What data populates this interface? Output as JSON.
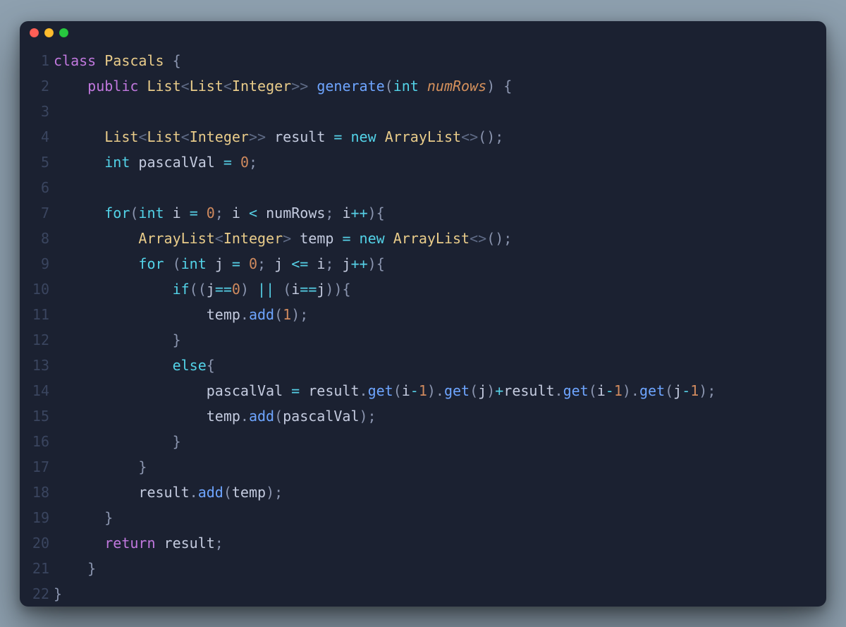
{
  "window": {
    "traffic": [
      "close",
      "minimize",
      "zoom"
    ]
  },
  "theme": {
    "background": "#1b2131",
    "page_background": "#8ea0af",
    "keyword": "#c178de",
    "control": "#53d3e8",
    "class": "#e9cc8a",
    "function": "#6ea5ff",
    "identifier": "#c4cbdf",
    "punct": "#8b95af",
    "angle": "#5f6b86",
    "operator": "#56d0e6",
    "number": "#d08a5e",
    "parameter": "#d6915c",
    "gutter": "#3a455f"
  },
  "lines": [
    {
      "n": "1",
      "tokens": [
        {
          "c": "kw",
          "t": "class"
        },
        {
          "c": "sp",
          "t": " "
        },
        {
          "c": "cls",
          "t": "Pascals"
        },
        {
          "c": "sp",
          "t": " "
        },
        {
          "c": "punct",
          "t": "{"
        }
      ]
    },
    {
      "n": "2",
      "tokens": [
        {
          "c": "sp",
          "t": "    "
        },
        {
          "c": "kw",
          "t": "public"
        },
        {
          "c": "sp",
          "t": " "
        },
        {
          "c": "cls",
          "t": "List"
        },
        {
          "c": "angle",
          "t": "<"
        },
        {
          "c": "cls",
          "t": "List"
        },
        {
          "c": "angle",
          "t": "<"
        },
        {
          "c": "cls",
          "t": "Integer"
        },
        {
          "c": "angle",
          "t": ">>"
        },
        {
          "c": "sp",
          "t": " "
        },
        {
          "c": "fn",
          "t": "generate"
        },
        {
          "c": "punct",
          "t": "("
        },
        {
          "c": "type",
          "t": "int"
        },
        {
          "c": "sp",
          "t": " "
        },
        {
          "c": "param",
          "t": "numRows"
        },
        {
          "c": "punct",
          "t": ")"
        },
        {
          "c": "sp",
          "t": " "
        },
        {
          "c": "punct",
          "t": "{"
        }
      ]
    },
    {
      "n": "3",
      "tokens": []
    },
    {
      "n": "4",
      "tokens": [
        {
          "c": "sp",
          "t": "      "
        },
        {
          "c": "cls",
          "t": "List"
        },
        {
          "c": "angle",
          "t": "<"
        },
        {
          "c": "cls",
          "t": "List"
        },
        {
          "c": "angle",
          "t": "<"
        },
        {
          "c": "cls",
          "t": "Integer"
        },
        {
          "c": "angle",
          "t": ">>"
        },
        {
          "c": "sp",
          "t": " "
        },
        {
          "c": "ident",
          "t": "result"
        },
        {
          "c": "sp",
          "t": " "
        },
        {
          "c": "op",
          "t": "="
        },
        {
          "c": "sp",
          "t": " "
        },
        {
          "c": "ctrl",
          "t": "new"
        },
        {
          "c": "sp",
          "t": " "
        },
        {
          "c": "cls",
          "t": "ArrayList"
        },
        {
          "c": "angle",
          "t": "<>"
        },
        {
          "c": "punct",
          "t": "();"
        }
      ]
    },
    {
      "n": "5",
      "tokens": [
        {
          "c": "sp",
          "t": "      "
        },
        {
          "c": "type",
          "t": "int"
        },
        {
          "c": "sp",
          "t": " "
        },
        {
          "c": "ident",
          "t": "pascalVal"
        },
        {
          "c": "sp",
          "t": " "
        },
        {
          "c": "op",
          "t": "="
        },
        {
          "c": "sp",
          "t": " "
        },
        {
          "c": "num",
          "t": "0"
        },
        {
          "c": "punct",
          "t": ";"
        }
      ]
    },
    {
      "n": "6",
      "tokens": []
    },
    {
      "n": "7",
      "tokens": [
        {
          "c": "sp",
          "t": "      "
        },
        {
          "c": "ctrl",
          "t": "for"
        },
        {
          "c": "punct",
          "t": "("
        },
        {
          "c": "type",
          "t": "int"
        },
        {
          "c": "sp",
          "t": " "
        },
        {
          "c": "ident",
          "t": "i"
        },
        {
          "c": "sp",
          "t": " "
        },
        {
          "c": "op",
          "t": "="
        },
        {
          "c": "sp",
          "t": " "
        },
        {
          "c": "num",
          "t": "0"
        },
        {
          "c": "punct",
          "t": ";"
        },
        {
          "c": "sp",
          "t": " "
        },
        {
          "c": "ident",
          "t": "i"
        },
        {
          "c": "sp",
          "t": " "
        },
        {
          "c": "op",
          "t": "<"
        },
        {
          "c": "sp",
          "t": " "
        },
        {
          "c": "ident",
          "t": "numRows"
        },
        {
          "c": "punct",
          "t": ";"
        },
        {
          "c": "sp",
          "t": " "
        },
        {
          "c": "ident",
          "t": "i"
        },
        {
          "c": "op",
          "t": "++"
        },
        {
          "c": "punct",
          "t": "){"
        }
      ]
    },
    {
      "n": "8",
      "tokens": [
        {
          "c": "sp",
          "t": "          "
        },
        {
          "c": "cls",
          "t": "ArrayList"
        },
        {
          "c": "angle",
          "t": "<"
        },
        {
          "c": "cls",
          "t": "Integer"
        },
        {
          "c": "angle",
          "t": ">"
        },
        {
          "c": "sp",
          "t": " "
        },
        {
          "c": "ident",
          "t": "temp"
        },
        {
          "c": "sp",
          "t": " "
        },
        {
          "c": "op",
          "t": "="
        },
        {
          "c": "sp",
          "t": " "
        },
        {
          "c": "ctrl",
          "t": "new"
        },
        {
          "c": "sp",
          "t": " "
        },
        {
          "c": "cls",
          "t": "ArrayList"
        },
        {
          "c": "angle",
          "t": "<>"
        },
        {
          "c": "punct",
          "t": "();"
        }
      ]
    },
    {
      "n": "9",
      "tokens": [
        {
          "c": "sp",
          "t": "          "
        },
        {
          "c": "ctrl",
          "t": "for"
        },
        {
          "c": "sp",
          "t": " "
        },
        {
          "c": "punct",
          "t": "("
        },
        {
          "c": "type",
          "t": "int"
        },
        {
          "c": "sp",
          "t": " "
        },
        {
          "c": "ident",
          "t": "j"
        },
        {
          "c": "sp",
          "t": " "
        },
        {
          "c": "op",
          "t": "="
        },
        {
          "c": "sp",
          "t": " "
        },
        {
          "c": "num",
          "t": "0"
        },
        {
          "c": "punct",
          "t": ";"
        },
        {
          "c": "sp",
          "t": " "
        },
        {
          "c": "ident",
          "t": "j"
        },
        {
          "c": "sp",
          "t": " "
        },
        {
          "c": "op",
          "t": "<="
        },
        {
          "c": "sp",
          "t": " "
        },
        {
          "c": "ident",
          "t": "i"
        },
        {
          "c": "punct",
          "t": ";"
        },
        {
          "c": "sp",
          "t": " "
        },
        {
          "c": "ident",
          "t": "j"
        },
        {
          "c": "op",
          "t": "++"
        },
        {
          "c": "punct",
          "t": "){"
        }
      ]
    },
    {
      "n": "10",
      "tokens": [
        {
          "c": "sp",
          "t": "              "
        },
        {
          "c": "ctrl",
          "t": "if"
        },
        {
          "c": "punct",
          "t": "(("
        },
        {
          "c": "ident",
          "t": "j"
        },
        {
          "c": "op",
          "t": "=="
        },
        {
          "c": "num",
          "t": "0"
        },
        {
          "c": "punct",
          "t": ")"
        },
        {
          "c": "sp",
          "t": " "
        },
        {
          "c": "op",
          "t": "||"
        },
        {
          "c": "sp",
          "t": " "
        },
        {
          "c": "punct",
          "t": "("
        },
        {
          "c": "ident",
          "t": "i"
        },
        {
          "c": "op",
          "t": "=="
        },
        {
          "c": "ident",
          "t": "j"
        },
        {
          "c": "punct",
          "t": ")){"
        }
      ]
    },
    {
      "n": "11",
      "tokens": [
        {
          "c": "sp",
          "t": "                  "
        },
        {
          "c": "ident",
          "t": "temp"
        },
        {
          "c": "punct",
          "t": "."
        },
        {
          "c": "fn",
          "t": "add"
        },
        {
          "c": "punct",
          "t": "("
        },
        {
          "c": "num",
          "t": "1"
        },
        {
          "c": "punct",
          "t": ");"
        }
      ]
    },
    {
      "n": "12",
      "tokens": [
        {
          "c": "sp",
          "t": "              "
        },
        {
          "c": "punct",
          "t": "}"
        }
      ]
    },
    {
      "n": "13",
      "tokens": [
        {
          "c": "sp",
          "t": "              "
        },
        {
          "c": "ctrl",
          "t": "else"
        },
        {
          "c": "punct",
          "t": "{"
        }
      ]
    },
    {
      "n": "14",
      "tokens": [
        {
          "c": "sp",
          "t": "                  "
        },
        {
          "c": "ident",
          "t": "pascalVal"
        },
        {
          "c": "sp",
          "t": " "
        },
        {
          "c": "op",
          "t": "="
        },
        {
          "c": "sp",
          "t": " "
        },
        {
          "c": "ident",
          "t": "result"
        },
        {
          "c": "punct",
          "t": "."
        },
        {
          "c": "fn",
          "t": "get"
        },
        {
          "c": "punct",
          "t": "("
        },
        {
          "c": "ident",
          "t": "i"
        },
        {
          "c": "op",
          "t": "-"
        },
        {
          "c": "num",
          "t": "1"
        },
        {
          "c": "punct",
          "t": ")."
        },
        {
          "c": "fn",
          "t": "get"
        },
        {
          "c": "punct",
          "t": "("
        },
        {
          "c": "ident",
          "t": "j"
        },
        {
          "c": "punct",
          "t": ")"
        },
        {
          "c": "op",
          "t": "+"
        },
        {
          "c": "ident",
          "t": "result"
        },
        {
          "c": "punct",
          "t": "."
        },
        {
          "c": "fn",
          "t": "get"
        },
        {
          "c": "punct",
          "t": "("
        },
        {
          "c": "ident",
          "t": "i"
        },
        {
          "c": "op",
          "t": "-"
        },
        {
          "c": "num",
          "t": "1"
        },
        {
          "c": "punct",
          "t": ")."
        },
        {
          "c": "fn",
          "t": "get"
        },
        {
          "c": "punct",
          "t": "("
        },
        {
          "c": "ident",
          "t": "j"
        },
        {
          "c": "op",
          "t": "-"
        },
        {
          "c": "num",
          "t": "1"
        },
        {
          "c": "punct",
          "t": ");"
        }
      ]
    },
    {
      "n": "15",
      "tokens": [
        {
          "c": "sp",
          "t": "                  "
        },
        {
          "c": "ident",
          "t": "temp"
        },
        {
          "c": "punct",
          "t": "."
        },
        {
          "c": "fn",
          "t": "add"
        },
        {
          "c": "punct",
          "t": "("
        },
        {
          "c": "ident",
          "t": "pascalVal"
        },
        {
          "c": "punct",
          "t": ");"
        }
      ]
    },
    {
      "n": "16",
      "tokens": [
        {
          "c": "sp",
          "t": "              "
        },
        {
          "c": "punct",
          "t": "}"
        }
      ]
    },
    {
      "n": "17",
      "tokens": [
        {
          "c": "sp",
          "t": "          "
        },
        {
          "c": "punct",
          "t": "}"
        }
      ]
    },
    {
      "n": "18",
      "tokens": [
        {
          "c": "sp",
          "t": "          "
        },
        {
          "c": "ident",
          "t": "result"
        },
        {
          "c": "punct",
          "t": "."
        },
        {
          "c": "fn",
          "t": "add"
        },
        {
          "c": "punct",
          "t": "("
        },
        {
          "c": "ident",
          "t": "temp"
        },
        {
          "c": "punct",
          "t": ");"
        }
      ]
    },
    {
      "n": "19",
      "tokens": [
        {
          "c": "sp",
          "t": "      "
        },
        {
          "c": "punct",
          "t": "}"
        }
      ]
    },
    {
      "n": "20",
      "tokens": [
        {
          "c": "sp",
          "t": "      "
        },
        {
          "c": "kw",
          "t": "return"
        },
        {
          "c": "sp",
          "t": " "
        },
        {
          "c": "ident",
          "t": "result"
        },
        {
          "c": "punct",
          "t": ";"
        }
      ]
    },
    {
      "n": "21",
      "tokens": [
        {
          "c": "sp",
          "t": "    "
        },
        {
          "c": "punct",
          "t": "}"
        }
      ]
    },
    {
      "n": "22",
      "tokens": [
        {
          "c": "punct",
          "t": "}"
        }
      ]
    }
  ]
}
